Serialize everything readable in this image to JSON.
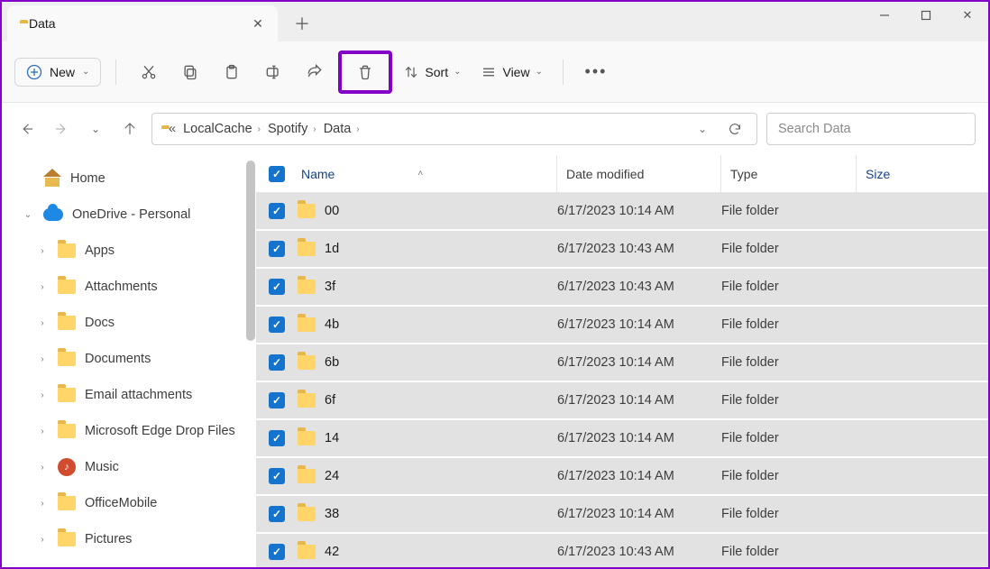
{
  "window": {
    "tab_title": "Data",
    "min_tip": "Minimize",
    "max_tip": "Maximize",
    "close_tip": "Close"
  },
  "toolbar": {
    "new_label": "New",
    "sort_label": "Sort",
    "view_label": "View"
  },
  "address": {
    "crumbs": [
      "LocalCache",
      "Spotify",
      "Data"
    ]
  },
  "search": {
    "placeholder": "Search Data"
  },
  "sidebar": {
    "items": [
      {
        "label": "Home",
        "icon": "home",
        "chev": ""
      },
      {
        "label": "OneDrive - Personal",
        "icon": "cloud",
        "chev": "v"
      },
      {
        "label": "Apps",
        "icon": "folder",
        "chev": ">"
      },
      {
        "label": "Attachments",
        "icon": "folder",
        "chev": ">"
      },
      {
        "label": "Docs",
        "icon": "folder",
        "chev": ">"
      },
      {
        "label": "Documents",
        "icon": "folder",
        "chev": ">"
      },
      {
        "label": "Email attachments",
        "icon": "folder",
        "chev": ">"
      },
      {
        "label": "Microsoft Edge Drop Files",
        "icon": "folder",
        "chev": ">"
      },
      {
        "label": "Music",
        "icon": "music",
        "chev": ">"
      },
      {
        "label": "OfficeMobile",
        "icon": "folder",
        "chev": ">"
      },
      {
        "label": "Pictures",
        "icon": "folder",
        "chev": ">"
      }
    ]
  },
  "columns": {
    "name": "Name",
    "date": "Date modified",
    "type": "Type",
    "size": "Size"
  },
  "rows": [
    {
      "name": "00",
      "date": "6/17/2023 10:14 AM",
      "type": "File folder"
    },
    {
      "name": "1d",
      "date": "6/17/2023 10:43 AM",
      "type": "File folder"
    },
    {
      "name": "3f",
      "date": "6/17/2023 10:43 AM",
      "type": "File folder"
    },
    {
      "name": "4b",
      "date": "6/17/2023 10:14 AM",
      "type": "File folder"
    },
    {
      "name": "6b",
      "date": "6/17/2023 10:14 AM",
      "type": "File folder"
    },
    {
      "name": "6f",
      "date": "6/17/2023 10:14 AM",
      "type": "File folder"
    },
    {
      "name": "14",
      "date": "6/17/2023 10:14 AM",
      "type": "File folder"
    },
    {
      "name": "24",
      "date": "6/17/2023 10:14 AM",
      "type": "File folder"
    },
    {
      "name": "38",
      "date": "6/17/2023 10:14 AM",
      "type": "File folder"
    },
    {
      "name": "42",
      "date": "6/17/2023 10:43 AM",
      "type": "File folder"
    }
  ]
}
